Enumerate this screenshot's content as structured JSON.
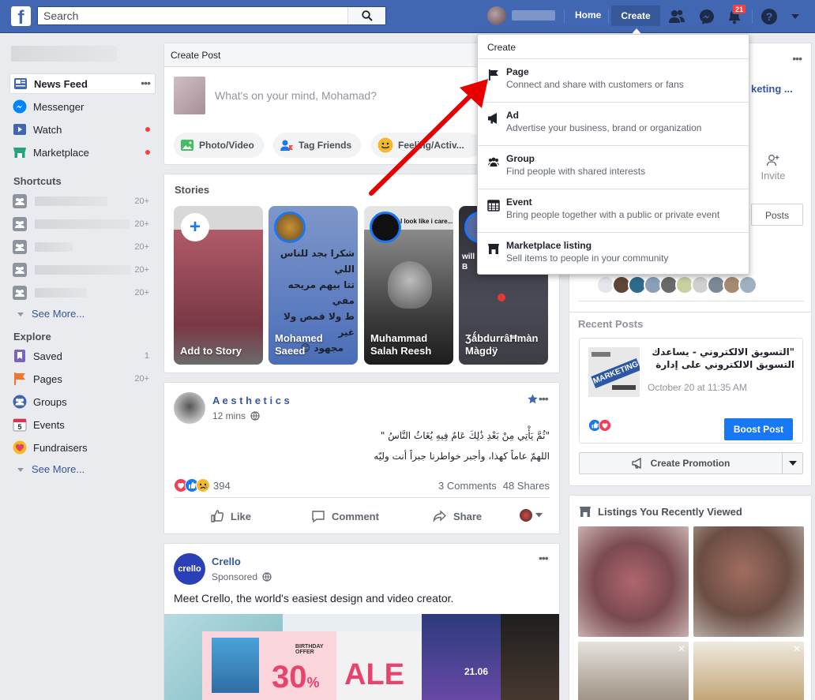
{
  "topbar": {
    "search_placeholder": "Search",
    "home": "Home",
    "create": "Create",
    "notif_count": "21"
  },
  "leftnav": {
    "items": [
      {
        "label": "News Feed"
      },
      {
        "label": "Messenger"
      },
      {
        "label": "Watch"
      },
      {
        "label": "Marketplace"
      }
    ],
    "shortcuts_title": "Shortcuts",
    "shortcut_counts": [
      "20+",
      "20+",
      "20+",
      "20+",
      "20+"
    ],
    "see_more": "See More...",
    "explore_title": "Explore",
    "explore": [
      {
        "label": "Saved",
        "count": "1"
      },
      {
        "label": "Pages",
        "count": "20+"
      },
      {
        "label": "Groups",
        "count": ""
      },
      {
        "label": "Events",
        "count": ""
      },
      {
        "label": "Fundraisers",
        "count": ""
      }
    ],
    "events_day": "5"
  },
  "create_post": {
    "title": "Create Post",
    "placeholder": "What's on your mind, Mohamad?",
    "photo_video": "Photo/Video",
    "tag_friends": "Tag Friends",
    "feeling": "Feeling/Activ..."
  },
  "stories": {
    "title": "Stories",
    "items": [
      {
        "name": "Add to Story"
      },
      {
        "name": "Mohamed\nSaeed",
        "line1": "Mohamed",
        "line2": "Saeed",
        "arabic": [
          "شكرا بجد للناس اللي",
          "تتا بيهم مريحه مفي",
          "ط ولا قمص ولا غير",
          "مجهود 😊"
        ]
      },
      {
        "name": "Muhammad\nSalah Reesh",
        "line1": "Muhammad",
        "line2": "Salah Reesh",
        "caption": "I look like i care..."
      },
      {
        "name": "ƷǻbdurrâĦmàn\nMàgdÿ",
        "line1": "ƷǻbdurrâĦmàn",
        "line2": "Màgdÿ",
        "caption": "will\nB"
      }
    ]
  },
  "post": {
    "author": "A e s t h e t i c s",
    "time": "12 mins",
    "line1": "\"ثُمَّ يَأْتِي مِنْ بَعْدِ ذَٰلِكَ عَامٌ فِيهِ يُغَاثُ النَّاسُ \"",
    "line2": "اللهمّ عاماً كهذا، وأجبر خواطرنا جبراً أنت وليّه",
    "reactions": "394",
    "comments": "3 Comments",
    "shares": "48 Shares",
    "like": "Like",
    "comment": "Comment",
    "share": "Share"
  },
  "ad": {
    "author": "Crello",
    "logo": "crello",
    "sponsored": "Sponsored",
    "text": "Meet Crello, the world's easiest and video creator.",
    "text_full": "Meet Crello, the world's easiest design and video creator.",
    "birthday": "BIRTHDAY\nOFFER",
    "percent": "30",
    "percent_sign": "%",
    "sale": "ALE",
    "date": "21.06"
  },
  "right": {
    "page_name_fragment": "keting ...",
    "invite": "Invite",
    "posts": "Posts",
    "recent_posts_title": "Recent Posts",
    "recent_post_text": "\"التسويق الالكتروني - يساعدك التسويق الالكتروني على إدارة حملات اعلانية...",
    "recent_post_date": "October 20 at 11:35 AM",
    "boost": "Boost Post",
    "create_promotion": "Create Promotion",
    "listings_title": "Listings You Recently Viewed",
    "marketing_img": "MARKETING"
  },
  "dropdown": {
    "title": "Create",
    "items": [
      {
        "title": "Page",
        "desc": "Connect and share with customers or fans",
        "icon": "flag-icon"
      },
      {
        "title": "Ad",
        "desc": "Advertise your business, brand or organization",
        "icon": "megaphone-icon"
      },
      {
        "title": "Group",
        "desc": "Find people with shared interests",
        "icon": "group-icon"
      },
      {
        "title": "Event",
        "desc": "Bring people together with a public or private event",
        "icon": "calendar-icon"
      },
      {
        "title": "Marketplace listing",
        "desc": "Sell items to people in your community",
        "icon": "shop-icon"
      }
    ]
  },
  "colors": {
    "brand": "#4267b2",
    "link": "#365899",
    "notif": "#fa3e3e",
    "arrow": "#e60000"
  }
}
